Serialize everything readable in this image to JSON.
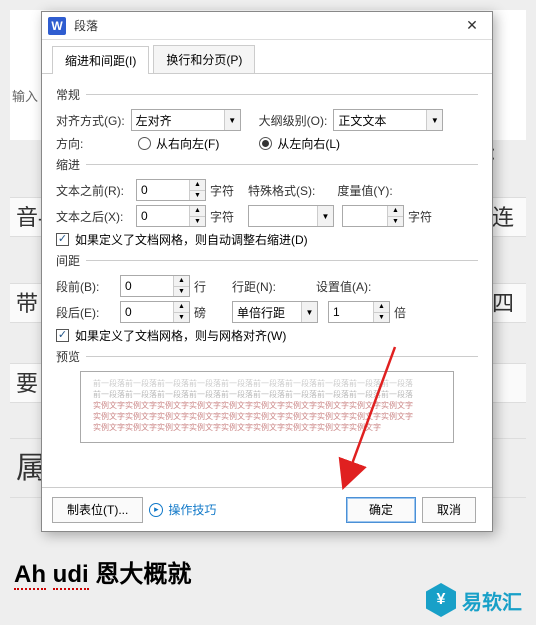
{
  "dialog": {
    "title": "段落",
    "app_icon_letter": "W",
    "close": "✕",
    "tabs": {
      "indent": "缩进和间距(I)",
      "page": "换行和分页(P)"
    },
    "sections": {
      "general": "常规",
      "indent": "缩进",
      "spacing": "间距",
      "preview": "预览"
    },
    "general": {
      "align_label": "对齐方式(G):",
      "align_value": "左对齐",
      "outline_label": "大纲级别(O):",
      "outline_value": "正文文本",
      "direction_label": "方向:",
      "rtl_label": "从右向左(F)",
      "ltr_label": "从左向右(L)"
    },
    "indent": {
      "before_label": "文本之前(R):",
      "before_value": "0",
      "after_label": "文本之后(X):",
      "after_value": "0",
      "unit_char": "字符",
      "special_label": "特殊格式(S):",
      "special_value": "",
      "measure_label": "度量值(Y):",
      "measure_value": "",
      "check_label": "如果定义了文档网格，则自动调整右缩进(D)"
    },
    "spacing": {
      "before_label": "段前(B):",
      "before_value": "0",
      "unit_line": "行",
      "after_label": "段后(E):",
      "after_value": "0",
      "unit_pt": "磅",
      "rule_label": "行距(N):",
      "rule_value": "单倍行距",
      "set_label": "设置值(A):",
      "set_value": "1",
      "unit_times": "倍",
      "check_label": "如果定义了文档网格，则与网格对齐(W)"
    },
    "preview_text": {
      "l1": "前一段落前一段落前一段落前一段落前一段落前一段落前一段落前一段落前一段落前一段落",
      "l2": "前一段落前一段落前一段落前一段落前一段落前一段落前一段落前一段落前一段落前一段落",
      "l3": "实例文字实例文字实例文字实例文字实例文字实例文字实例文字实例文字实例文字实例文字",
      "l4": "实例文字实例文字实例文字实例文字实例文字实例文字实例文字实例文字实例文字实例文字",
      "l5": "实例文字实例文字实例文字实例文字实例文字实例文字实例文字实例文字实例文字"
    },
    "buttons": {
      "tabs": "制表位(T)...",
      "tips": "操作技巧",
      "ok": "确定",
      "cancel": "取消"
    }
  },
  "background": {
    "input_hint": "输入",
    "line1_left": "音-",
    "line1_right": "连",
    "line1_top_right": "是：",
    "line2_left": "带    ",
    "line2_right": "四",
    "line3_left": "要",
    "line4_left": "属",
    "bottom_text_1": "Ah",
    "bottom_text_2": "udi",
    "bottom_text_3": " 恩大概就",
    "logo_text": "易软汇"
  }
}
